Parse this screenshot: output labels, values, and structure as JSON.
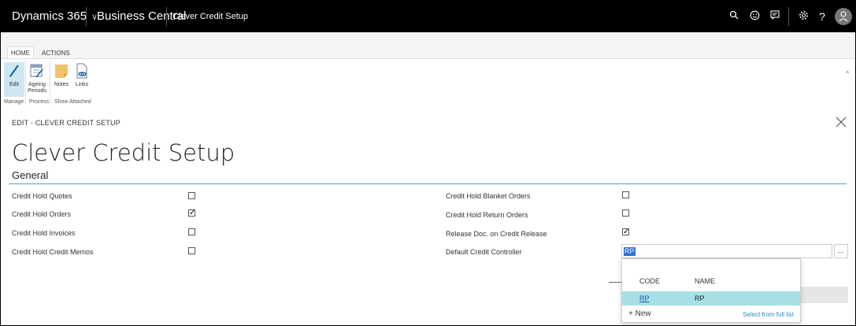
{
  "topbar": {
    "product": "Dynamics 365",
    "app": "Business Central",
    "page": "Clever Credit Setup",
    "avatar_icon": "person-icon",
    "icons": [
      "search-icon",
      "smiley-icon",
      "chat-icon",
      "gear-icon",
      "help-icon"
    ]
  },
  "ribbon": {
    "tabs": [
      "HOME",
      "ACTIONS"
    ],
    "buttons": {
      "edit": "Edit",
      "ageing_line1": "Ageing",
      "ageing_line2": "Periods",
      "notes": "Notes",
      "links": "Links"
    },
    "groups": {
      "manage": "Manage",
      "process": "Process",
      "show_attached": "Show Attached"
    }
  },
  "page": {
    "breadcrumb": "EDIT - CLEVER CREDIT SETUP",
    "title": "Clever Credit Setup",
    "section": "General"
  },
  "fields": {
    "left": [
      {
        "label": "Credit Hold Quotes",
        "checked": false
      },
      {
        "label": "Credit Hold Orders",
        "checked": true
      },
      {
        "label": "Credit Hold Invoices",
        "checked": false
      },
      {
        "label": "Credit Hold Credit Memos",
        "checked": false
      }
    ],
    "right": [
      {
        "label": "Credit Hold Blanket Orders",
        "checked": false
      },
      {
        "label": "Credit Hold Return Orders",
        "checked": false
      },
      {
        "label": "Release Doc. on Credit Release",
        "checked": true
      }
    ],
    "controller_label": "Default Credit Controller",
    "controller_value": "RP",
    "lookup_button": "..."
  },
  "dropdown": {
    "col_code": "CODE",
    "col_name": "NAME",
    "row_code": "RP",
    "row_name": "RP",
    "new": "+ New",
    "select_full": "Select from full list"
  },
  "colors": {
    "accent": "#3ab0bf",
    "selection": "#a7dfe6",
    "topbar": "#000000"
  }
}
